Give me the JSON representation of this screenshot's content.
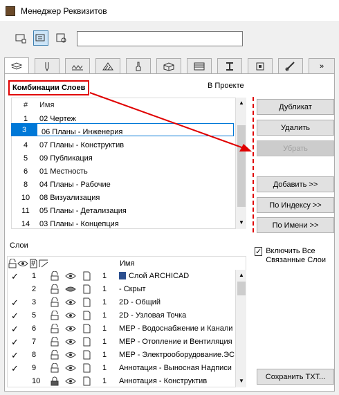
{
  "window": {
    "title": "Менеджер Реквизитов"
  },
  "toolbar": {
    "icons": [
      "table-view-icon",
      "list-view-icon",
      "preview-icon"
    ],
    "search_value": ""
  },
  "tabs": [
    "layers-icon",
    "pen-icon",
    "line-type-icon",
    "fill-icon",
    "material-icon",
    "composite-icon",
    "profile-icon",
    "zone-icon",
    "mep-icon",
    "markup-icon",
    "brush-icon"
  ],
  "combinations": {
    "title": "Комбинации Слоев",
    "in_project": "В Проекте",
    "headers": {
      "num": "#",
      "name": "Имя"
    },
    "rows": [
      {
        "num": "1",
        "name": "02 Чертеж"
      },
      {
        "num": "3",
        "name": "06 Планы - Инженерия"
      },
      {
        "num": "4",
        "name": "07 Планы - Конструктив"
      },
      {
        "num": "5",
        "name": "09 Публикация"
      },
      {
        "num": "6",
        "name": "01 Местность"
      },
      {
        "num": "8",
        "name": "04 Планы - Рабочие"
      },
      {
        "num": "10",
        "name": "08 Визуализация"
      },
      {
        "num": "11",
        "name": "05 Планы - Детализация"
      },
      {
        "num": "14",
        "name": "03 Планы - Концепция"
      }
    ]
  },
  "buttons": {
    "duplicate": "Дубликат",
    "delete": "Удалить",
    "remove": "Убрать",
    "add": "Добавить >>",
    "by_index": "По Индексу >>",
    "by_name": "По Имени >>",
    "save_txt": "Сохранить TXT..."
  },
  "layers": {
    "title": "Слои",
    "headers": {
      "num": "#",
      "name": "Имя"
    },
    "include_linked": "Включить Все Связанные Слои",
    "include_linked_checked": true,
    "rows": [
      {
        "check": "✓",
        "num": "1",
        "pen": "1",
        "name": "Слой ARCHICAD",
        "eye": "open",
        "lock": "open"
      },
      {
        "check": "",
        "num": "2",
        "pen": "1",
        "name": "- Скрыт",
        "eye": "closed",
        "lock": "open"
      },
      {
        "check": "✓",
        "num": "3",
        "pen": "1",
        "name": "2D - Общий",
        "eye": "open",
        "lock": "open"
      },
      {
        "check": "✓",
        "num": "5",
        "pen": "1",
        "name": "2D - Узловая Точка",
        "eye": "open",
        "lock": "open"
      },
      {
        "check": "✓",
        "num": "6",
        "pen": "1",
        "name": "MEP - Водоснабжение и Канали",
        "eye": "open",
        "lock": "open"
      },
      {
        "check": "✓",
        "num": "7",
        "pen": "1",
        "name": "MEP - Отопление и Вентиляция",
        "eye": "open",
        "lock": "open"
      },
      {
        "check": "✓",
        "num": "8",
        "pen": "1",
        "name": "MEP - Электрооборудование.ЭС",
        "eye": "open",
        "lock": "open"
      },
      {
        "check": "✓",
        "num": "9",
        "pen": "1",
        "name": "Аннотация - Выносная Надписи",
        "eye": "open",
        "lock": "open"
      },
      {
        "check": "",
        "num": "10",
        "pen": "1",
        "name": "Аннотация - Конструктив",
        "eye": "open",
        "lock": "closed"
      }
    ]
  },
  "colors": {
    "accent": "#0078d7",
    "annotation": "#e00000"
  }
}
